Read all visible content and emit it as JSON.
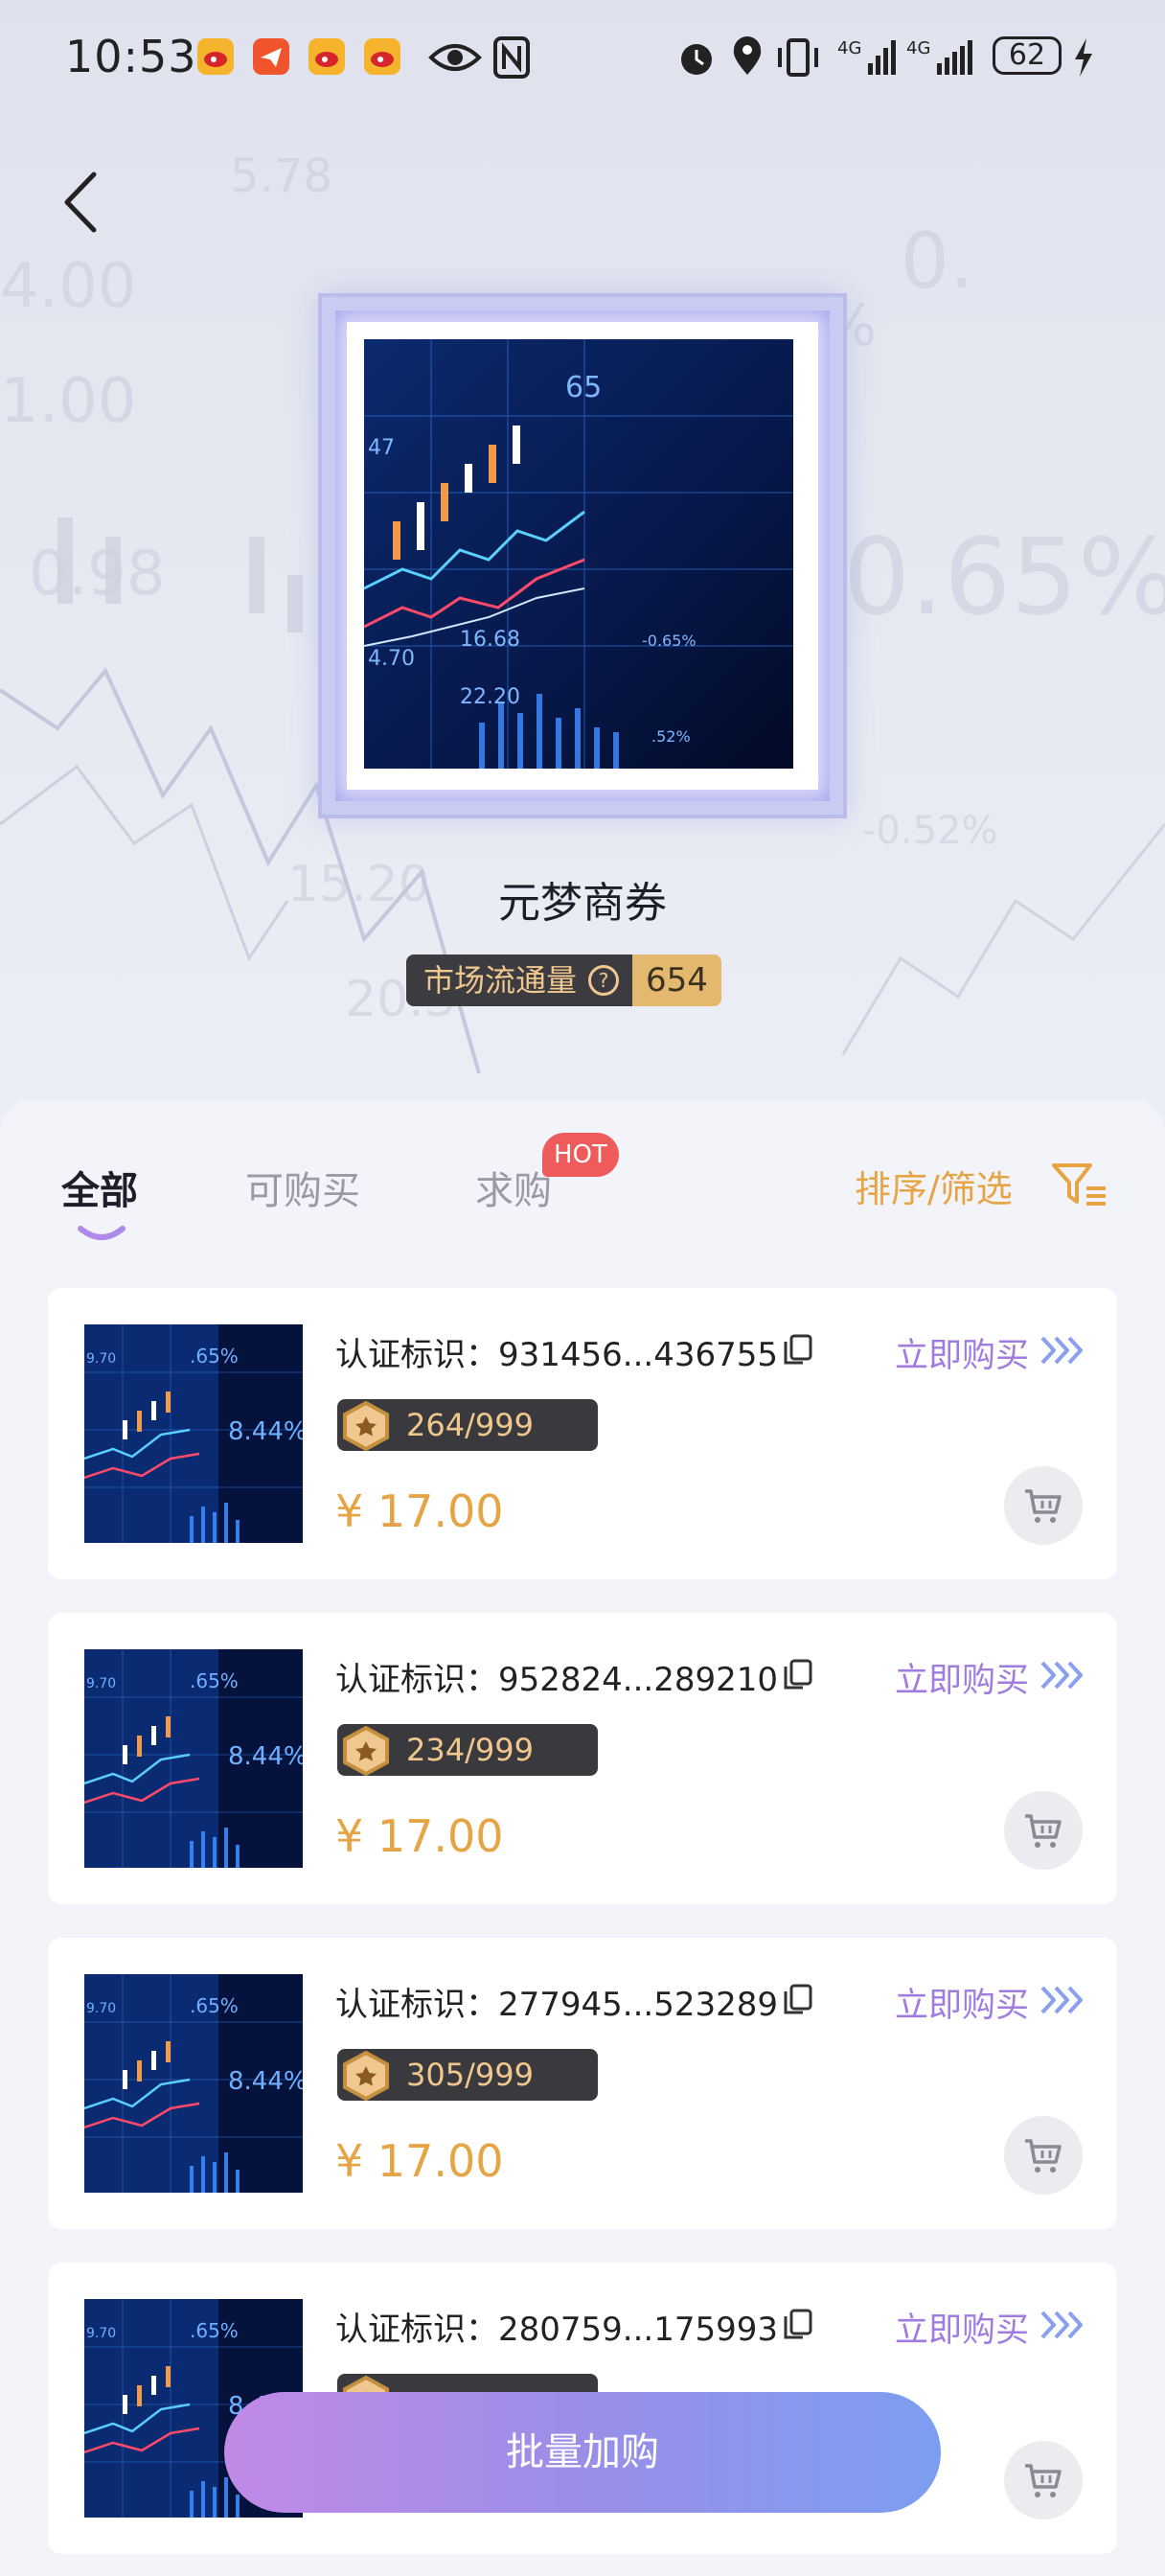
{
  "status_bar": {
    "time": "10:53",
    "battery": "62",
    "network_1": "4G",
    "network_2": "4G",
    "icons": [
      "weibo-icon",
      "telegram-icon",
      "weibo-icon",
      "weibo-icon",
      "eye-icon",
      "nfc-icon",
      "alarm-icon",
      "location-icon",
      "vibrate-icon",
      "signal-icon",
      "signal-icon",
      "battery-icon",
      "charging-icon"
    ]
  },
  "header": {
    "back_icon": "chevron-left-icon",
    "collection_title": "元梦商券",
    "circulation_label": "市场流通量",
    "circulation_value": "654"
  },
  "tabs": [
    {
      "label": "全部",
      "active": true
    },
    {
      "label": "可购买",
      "active": false
    },
    {
      "label": "求购",
      "active": false,
      "badge": "HOT"
    }
  ],
  "sort_filter": {
    "label": "排序/筛选",
    "icon": "filter-icon"
  },
  "listings": [
    {
      "cert_label": "认证标识：",
      "cert_id": "931456...436755",
      "buy_label": "立即购买",
      "edition": "264/999",
      "price": "¥ 17.00"
    },
    {
      "cert_label": "认证标识：",
      "cert_id": "952824...289210",
      "buy_label": "立即购买",
      "edition": "234/999",
      "price": "¥ 17.00"
    },
    {
      "cert_label": "认证标识：",
      "cert_id": "277945...523289",
      "buy_label": "立即购买",
      "edition": "305/999",
      "price": "¥ 17.00"
    },
    {
      "cert_label": "认证标识：",
      "cert_id": "280759...175993",
      "buy_label": "立即购买",
      "edition": "",
      "price": ""
    }
  ],
  "bulk_button": {
    "label": "批量加购"
  },
  "colors": {
    "accent_gold": "#e6a445",
    "accent_purple": "#a07be0",
    "badge_red": "#ef5a5a",
    "button_gradient_start": "#c08ae6",
    "button_gradient_end": "#7c9ef0"
  }
}
